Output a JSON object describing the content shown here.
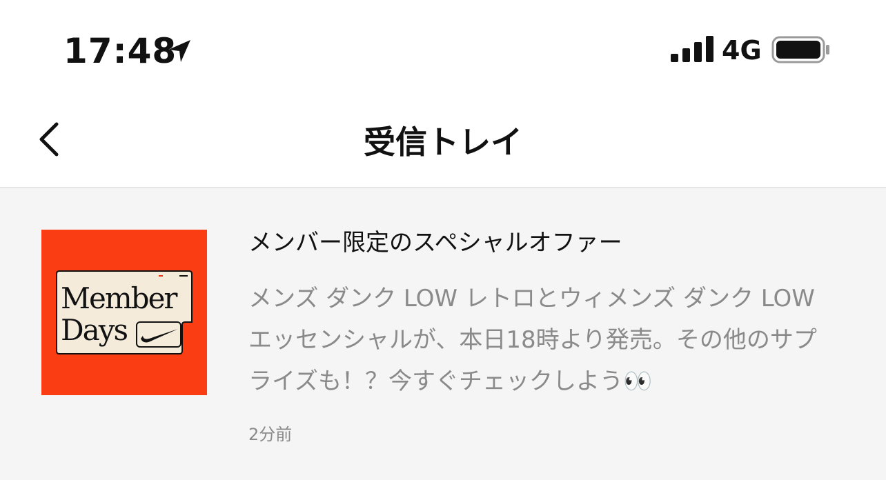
{
  "status_bar": {
    "time": "17:48",
    "location_icon": "location-arrow-icon",
    "signal_icon": "cellular-signal-icon",
    "network": "4G",
    "battery_icon": "battery-icon"
  },
  "nav": {
    "back_icon": "chevron-left-icon",
    "title": "受信トレイ"
  },
  "messages": [
    {
      "thumbnail": {
        "background_color": "#fa3d12",
        "card_color": "#f4ebdb",
        "logo_color": "#111111",
        "accent_color": "#e8340f",
        "text": "Member Days",
        "icon": "swoosh-logo-icon"
      },
      "title": "メンバー限定のスペシャルオファー",
      "body": "メンズ ダンク LOW レトロとウィメンズ ダンク LOW エッセンシャルが、本日18時より発売。その他のサプライズも！？今すぐチェックしよう👀",
      "time": "2分前"
    }
  ]
}
